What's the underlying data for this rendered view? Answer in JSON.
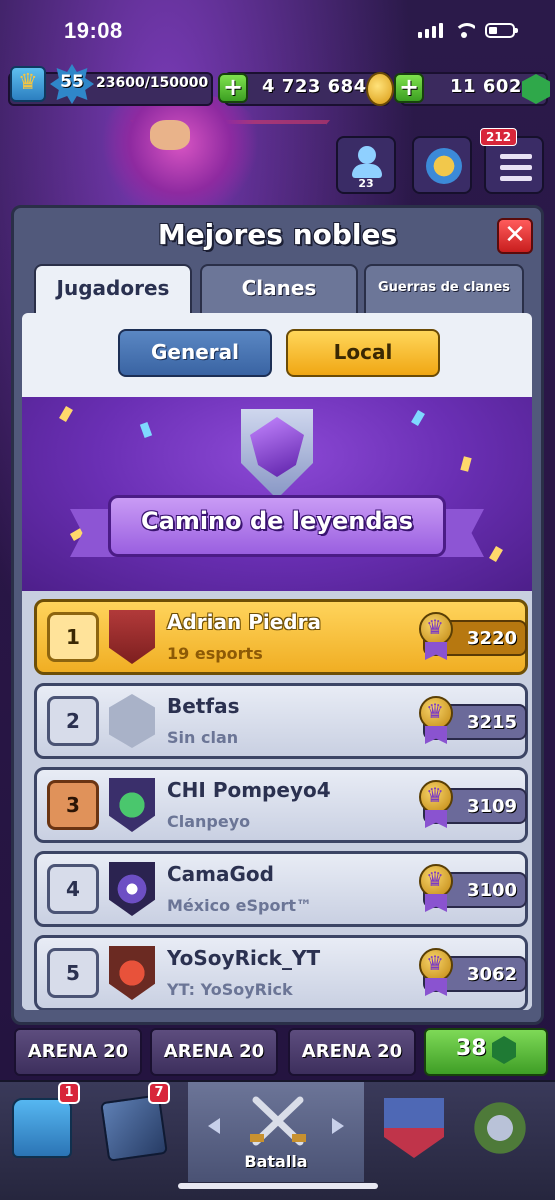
{
  "status_bar": {
    "time": "19:08"
  },
  "resources": {
    "level": "55",
    "xp": "23600/150000",
    "gold": "4 723 684",
    "gems": "11 602"
  },
  "side": {
    "friends_count": "23",
    "menu_badge": "212"
  },
  "modal": {
    "title": "Mejores nobles",
    "close_label": "✕",
    "tabs": [
      {
        "label": "Jugadores",
        "active": true
      },
      {
        "label": "Clanes",
        "active": false
      },
      {
        "label": "Guerras de clanes",
        "active": false
      }
    ],
    "segment": {
      "general": "General",
      "local": "Local",
      "selected": "Local"
    },
    "banner_title": "Camino de leyendas",
    "rows": [
      {
        "rank": "1",
        "name": "Adrian Piedra",
        "clan": "19 esports",
        "score": "3220"
      },
      {
        "rank": "2",
        "name": "Betfas",
        "clan": "Sin clan",
        "score": "3215"
      },
      {
        "rank": "3",
        "name": "CHI Pompeyo4",
        "clan": "Clanpeyo",
        "score": "3109"
      },
      {
        "rank": "4",
        "name": "CamaGod",
        "clan": "México eSport™",
        "score": "3100"
      },
      {
        "rank": "5",
        "name": "YoSoyRick_YT",
        "clan": "YT: YoSoyRick",
        "score": "3062"
      }
    ]
  },
  "arena": {
    "label": "ARENA 20",
    "reward_value": "38"
  },
  "nav": {
    "chest_badge": "1",
    "cards_badge": "7",
    "active_label": "Batalla"
  },
  "colors": {
    "gold_row": "#f0ae23",
    "accent_purple": "#6a2fb4",
    "close_red": "#c81e1e"
  }
}
